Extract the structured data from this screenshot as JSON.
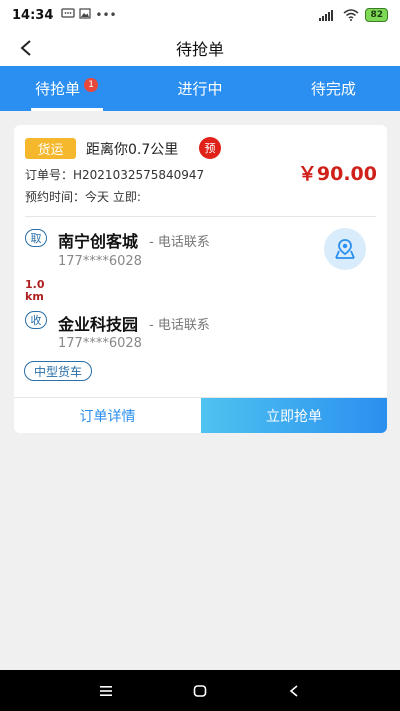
{
  "statusbar": {
    "time": "14:34",
    "battery": "82"
  },
  "header": {
    "title": "待抢单"
  },
  "tabs": [
    {
      "label": "待抢单",
      "badge": "1",
      "active": true
    },
    {
      "label": "进行中",
      "active": false
    },
    {
      "label": "待完成",
      "active": false
    }
  ],
  "order": {
    "type_tag": "货运",
    "distance": "距离你0.7公里",
    "pre_badge": "预",
    "order_no": "订单号：H2021032575840947",
    "appointment": "预约时间：今天 立即:",
    "price": "￥90.00",
    "pickup": {
      "tag": "取",
      "name": "南宁创客城",
      "contact": "- 电话联系",
      "phone": "177****6028"
    },
    "route_distance_value": "1.0",
    "route_distance_unit": "km",
    "dropoff": {
      "tag": "收",
      "name": "金业科技园",
      "contact": "- 电话联系",
      "phone": "177****6028"
    },
    "vehicle": "中型货车",
    "detail_button": "订单详情",
    "grab_button": "立即抢单"
  },
  "colors": {
    "primary": "#2a8ff0",
    "price": "#d0201a",
    "freight_tag": "#f5b82d",
    "pre_badge": "#e0211a"
  }
}
